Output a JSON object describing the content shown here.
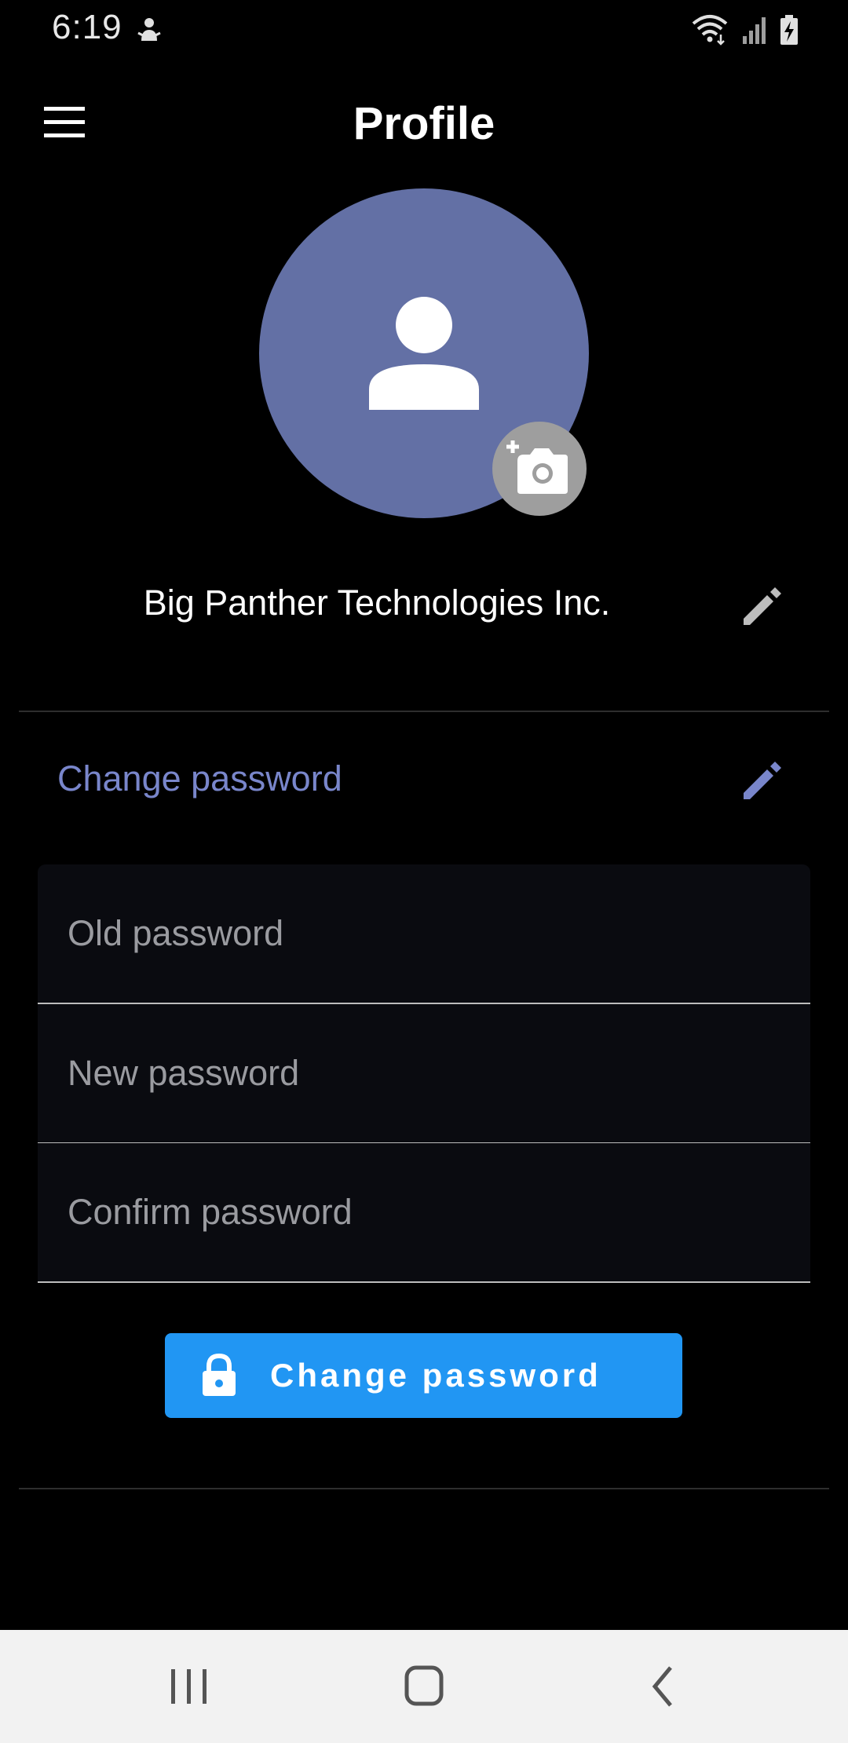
{
  "status_bar": {
    "time": "6:19",
    "icons": [
      "notification-icon",
      "wifi-icon",
      "signal-icon",
      "battery-charging-icon"
    ]
  },
  "app_bar": {
    "menu_icon": "menu-icon",
    "title": "Profile"
  },
  "profile": {
    "avatar_icon": "person-icon",
    "avatar_color": "#6370a5",
    "camera_icon": "add-photo-icon",
    "company_name": "Big Panther Technologies Inc.",
    "edit_icon": "pencil-icon"
  },
  "change_password": {
    "section_title": "Change password",
    "accent_color": "#7986cb",
    "fields": {
      "old_placeholder": "Old password",
      "new_placeholder": "New password",
      "confirm_placeholder": "Confirm password"
    },
    "button_label": "Change password",
    "button_color": "#2196f3",
    "button_icon": "lock-icon"
  },
  "nav_bar": {
    "recent_icon": "recent-apps-icon",
    "home_icon": "home-icon",
    "back_icon": "back-icon"
  }
}
